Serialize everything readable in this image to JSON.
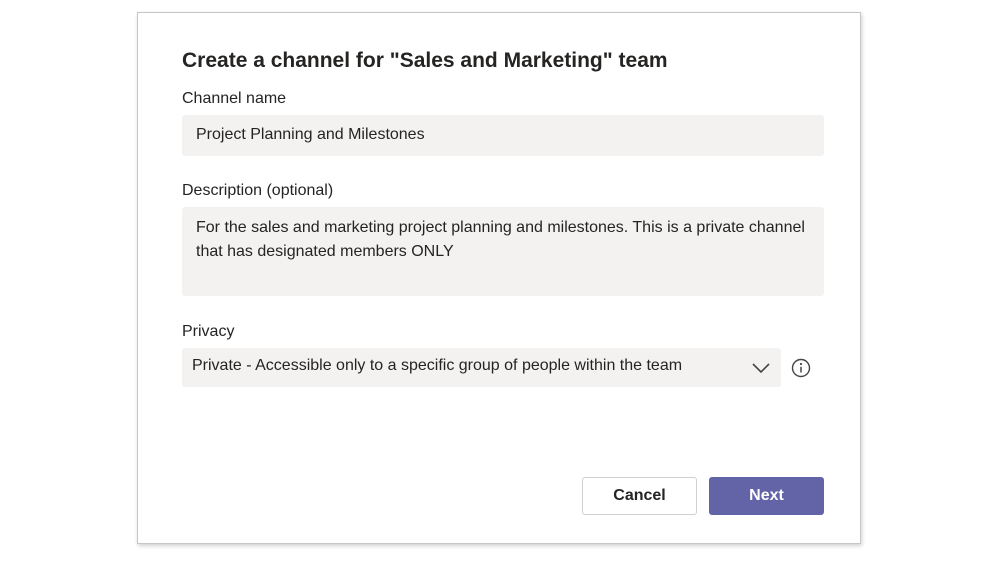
{
  "dialog": {
    "title": "Create a channel for \"Sales and Marketing\" team",
    "channel_name": {
      "label": "Channel name",
      "value": "Project Planning and Milestones"
    },
    "description": {
      "label": "Description (optional)",
      "value": "For the sales and marketing project planning and milestones. This is a private channel that has designated members ONLY"
    },
    "privacy": {
      "label": "Privacy",
      "selected": "Private - Accessible only to a specific group of people within the team",
      "dropdown_icon": "chevron-down-icon",
      "info_icon": "info-icon"
    },
    "buttons": {
      "cancel_label": "Cancel",
      "next_label": "Next"
    },
    "colors": {
      "primary": "#6264a7",
      "field_background": "#f3f2f1",
      "text": "#252423"
    }
  }
}
